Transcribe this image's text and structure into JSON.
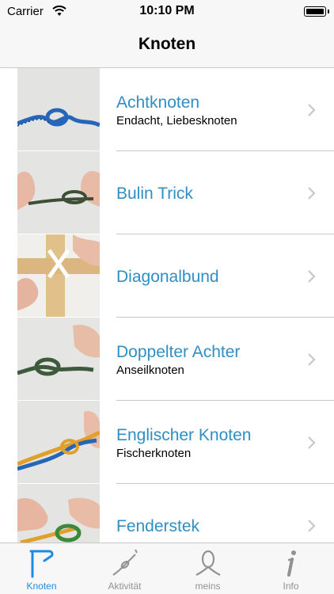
{
  "status_bar": {
    "carrier": "Carrier",
    "time": "10:10 PM"
  },
  "nav": {
    "title": "Knoten"
  },
  "rows": [
    {
      "title": "Achtknoten",
      "subtitle": "Endacht, Liebesknoten"
    },
    {
      "title": "Bulin Trick",
      "subtitle": ""
    },
    {
      "title": "Diagonalbund",
      "subtitle": ""
    },
    {
      "title": "Doppelter Achter",
      "subtitle": "Anseilknoten"
    },
    {
      "title": "Englischer Knoten",
      "subtitle": "Fischerknoten"
    },
    {
      "title": "Fenderstek",
      "subtitle": ""
    }
  ],
  "tabs": [
    {
      "label": "Knoten",
      "icon": "knot-icon",
      "active": true
    },
    {
      "label": "Aktivität",
      "icon": "rope-icon",
      "active": false
    },
    {
      "label": "meins",
      "icon": "loop-icon",
      "active": false
    },
    {
      "label": "Info",
      "icon": "info-icon",
      "active": false
    }
  ],
  "colors": {
    "accent": "#1a8ce3",
    "row_title": "#2f8fc4",
    "inactive": "#929292"
  }
}
